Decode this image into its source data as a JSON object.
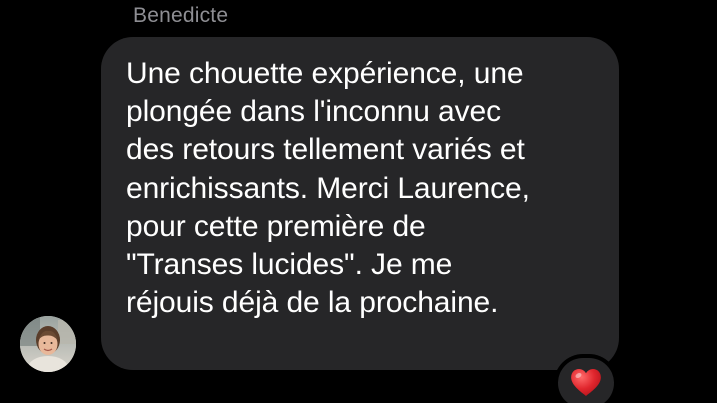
{
  "sender": {
    "name": "Benedicte",
    "avatar_icon": "person-photo-avatar"
  },
  "message": {
    "lines": [
      "Une chouette expérience, une",
      "plongée dans l'inconnu avec",
      "des retours tellement variés et",
      "enrichissants. Merci Laurence,",
      "pour cette première de",
      "\"Transes lucides\". Je me",
      "réjouis déjà de la prochaine."
    ]
  },
  "reaction": {
    "icon": "heart-icon",
    "color": "#e0262d"
  },
  "colors": {
    "background": "#000000",
    "bubble": "#262628",
    "sender_name": "#8e8e93",
    "text": "#ffffff"
  }
}
